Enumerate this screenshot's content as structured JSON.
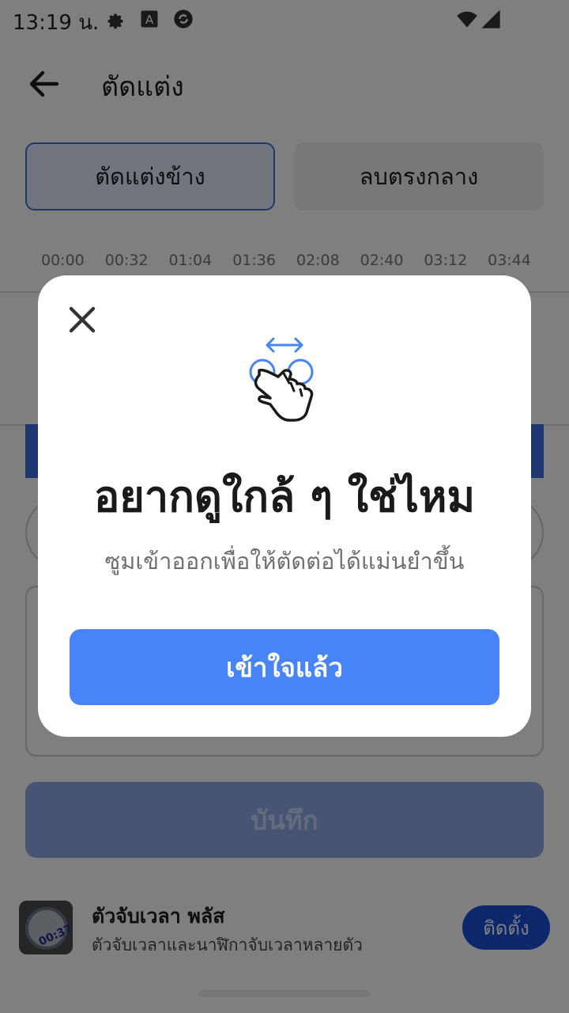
{
  "status_bar": {
    "time": "13:19 น.",
    "icons": [
      "settings-gear-icon",
      "keyboard-a-icon",
      "sync-app-icon",
      "wifi-icon",
      "cellular-signal-icon"
    ]
  },
  "app_bar": {
    "title": "ตัดแต่ง",
    "back_icon": "arrow-left-icon"
  },
  "mode_tabs": [
    {
      "label": "ตัดแต่งข้าง",
      "active": true
    },
    {
      "label": "ลบตรงกลาง",
      "active": false
    }
  ],
  "timeline": {
    "ticks": [
      "00:00",
      "00:32",
      "01:04",
      "01:36",
      "02:08",
      "02:40",
      "03:12",
      "03:44"
    ]
  },
  "save_button": {
    "label": "บันทึก"
  },
  "ad": {
    "title": "ตัวจับเวลา พลัส",
    "subtitle": "ตัวจับเวลาและนาฬิกาจับเวลาหลายตัว",
    "thumb_text": "00:37",
    "install_label": "ติดตั้ง"
  },
  "dialog": {
    "title": "อยากดูใกล้ ๆ ใช่ไหม",
    "body": "ซูมเข้าออกเพื่อให้ตัดต่อได้แม่นยำขึ้น",
    "button_label": "เข้าใจแล้ว",
    "close_icon": "close-icon",
    "illustration_icon": "pinch-zoom-hand-icon"
  },
  "colors": {
    "primary": "#4684f8",
    "install_button": "#1a4fd8",
    "tab_active_border": "#3d6fe0",
    "scrim": "rgba(0,0,0,0.5)"
  }
}
